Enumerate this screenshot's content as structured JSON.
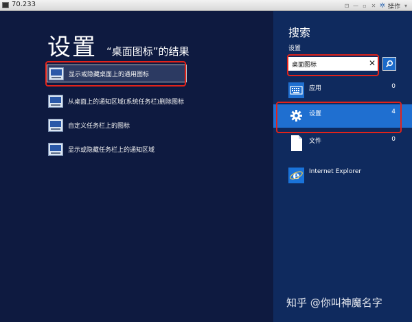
{
  "window": {
    "title": "70.233",
    "actions_label": "操作"
  },
  "main": {
    "title": "设置",
    "results_heading": "“桌面图标”的结果",
    "results": [
      {
        "label": "显示或隐藏桌面上的通用图标",
        "selected": true
      },
      {
        "label": "从桌面上的通知区域(系统任务栏)删除图标",
        "selected": false
      },
      {
        "label": "自定义任务栏上的图标",
        "selected": false
      },
      {
        "label": "显示或隐藏任务栏上的通知区域",
        "selected": false
      }
    ]
  },
  "charm": {
    "title": "搜索",
    "scope_label": "设置",
    "search_value": "桌面图标",
    "categories": [
      {
        "name": "应用",
        "count": "0",
        "icon": "apps-icon",
        "selected": false
      },
      {
        "name": "设置",
        "count": "4",
        "icon": "gear-icon",
        "selected": true
      },
      {
        "name": "文件",
        "count": "0",
        "icon": "file-icon",
        "selected": false
      },
      {
        "name": "Internet Explorer",
        "count": "",
        "icon": "internet-explorer-icon",
        "selected": false
      }
    ]
  },
  "watermark": "知乎 @你叫神魔名字",
  "colors": {
    "main_bg": "#0e1a40",
    "charm_bg": "#0f2a5e",
    "selected_category": "#1f6fd0",
    "annotation_red": "#e2231a"
  }
}
